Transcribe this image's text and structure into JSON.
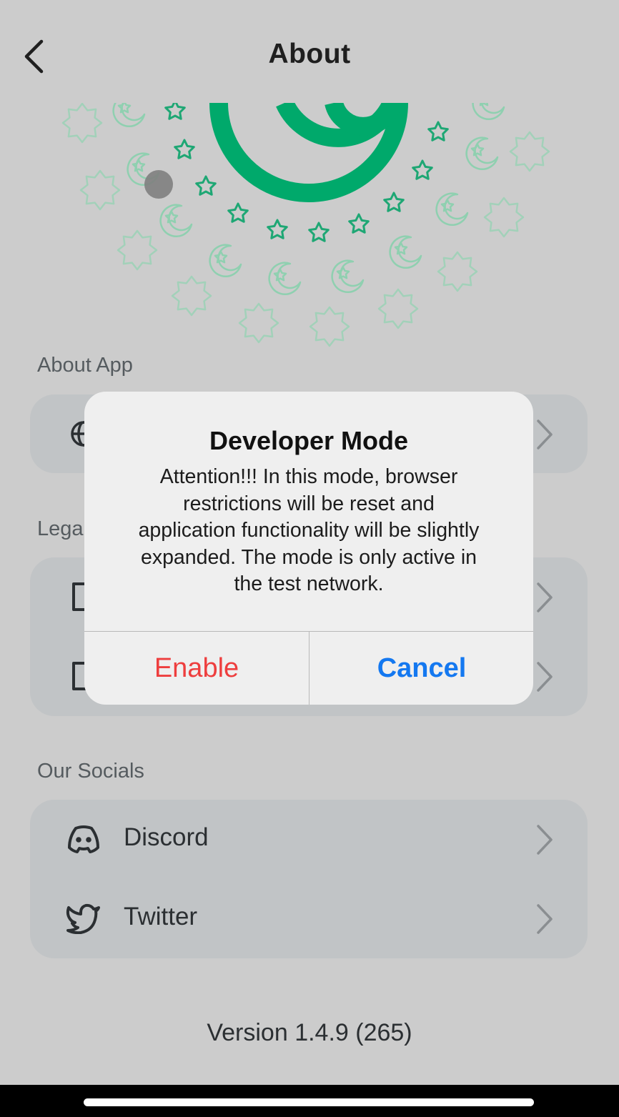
{
  "header": {
    "title": "About"
  },
  "sections": {
    "about_app": {
      "label": "About App",
      "items": [
        {
          "label": "",
          "icon": "globe-icon"
        }
      ]
    },
    "legal": {
      "label": "Legal",
      "items": [
        {
          "label": "",
          "icon": "document-icon"
        },
        {
          "label": "",
          "icon": "document-icon"
        }
      ]
    },
    "socials": {
      "label": "Our Socials",
      "items": [
        {
          "label": "Discord",
          "icon": "discord-icon"
        },
        {
          "label": "Twitter",
          "icon": "twitter-icon"
        }
      ]
    }
  },
  "version": "Version 1.4.9 (265)",
  "dialog": {
    "title": "Developer Mode",
    "message_lines": [
      "Attention!!! In this mode, browser",
      "restrictions will be reset and",
      "application functionality will be slightly",
      "expanded. The mode is only active in",
      "the test network."
    ],
    "enable_label": "Enable",
    "cancel_label": "Cancel"
  },
  "colors": {
    "brand_green": "#00a96b",
    "decor_green": "#3cc48c",
    "destructive_red": "#ee3e3e",
    "action_blue": "#1478f0"
  }
}
